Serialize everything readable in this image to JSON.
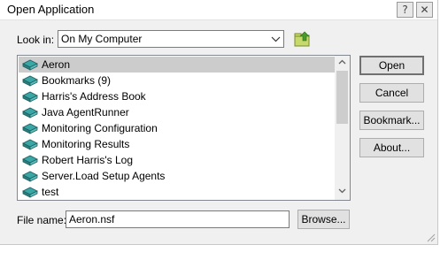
{
  "window": {
    "title": "Open Application",
    "help_glyph": "?",
    "close_glyph": "✕"
  },
  "look_in": {
    "label": "Look in:",
    "value": "On My Computer"
  },
  "list": {
    "items": [
      {
        "label": "Aeron",
        "selected": true
      },
      {
        "label": "Bookmarks (9)",
        "selected": false
      },
      {
        "label": "Harris's Address Book",
        "selected": false
      },
      {
        "label": "Java AgentRunner",
        "selected": false
      },
      {
        "label": "Monitoring Configuration",
        "selected": false
      },
      {
        "label": "Monitoring Results",
        "selected": false
      },
      {
        "label": "Robert Harris's Log",
        "selected": false
      },
      {
        "label": "Server.Load Setup Agents",
        "selected": false
      },
      {
        "label": "test",
        "selected": false
      }
    ]
  },
  "buttons": {
    "open": "Open",
    "cancel": "Cancel",
    "bookmark": "Bookmark...",
    "about": "About...",
    "browse": "Browse..."
  },
  "file_name": {
    "label": "File name:",
    "value": "Aeron.nsf"
  },
  "colors": {
    "dialog_bg": "#f0f0f0",
    "selection": "#cccccc",
    "icon_teal": "#3aa6a6"
  }
}
